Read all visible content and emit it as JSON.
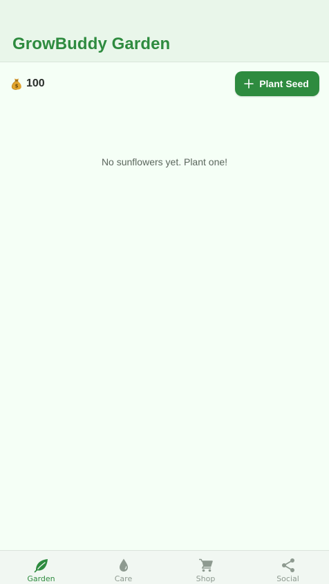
{
  "header": {
    "title": "GrowBuddy Garden"
  },
  "toolbar": {
    "coin_icon": "money-bag-icon",
    "coins": "100",
    "plant_button_icon": "plus-icon",
    "plant_button_label": "Plant Seed"
  },
  "garden": {
    "empty_message": "No sunflowers yet. Plant one!"
  },
  "bottom_nav": {
    "active": "Garden",
    "items": [
      {
        "label": "Garden",
        "icon": "leaf-icon"
      },
      {
        "label": "Care",
        "icon": "water-drop-icon"
      },
      {
        "label": "Shop",
        "icon": "cart-icon"
      },
      {
        "label": "Social",
        "icon": "share-icon"
      }
    ]
  },
  "colors": {
    "accent": "#2e8b3f",
    "header_bg": "#e9f6ea",
    "page_bg": "#f5fff6",
    "inactive_nav": "#8e9a90"
  }
}
